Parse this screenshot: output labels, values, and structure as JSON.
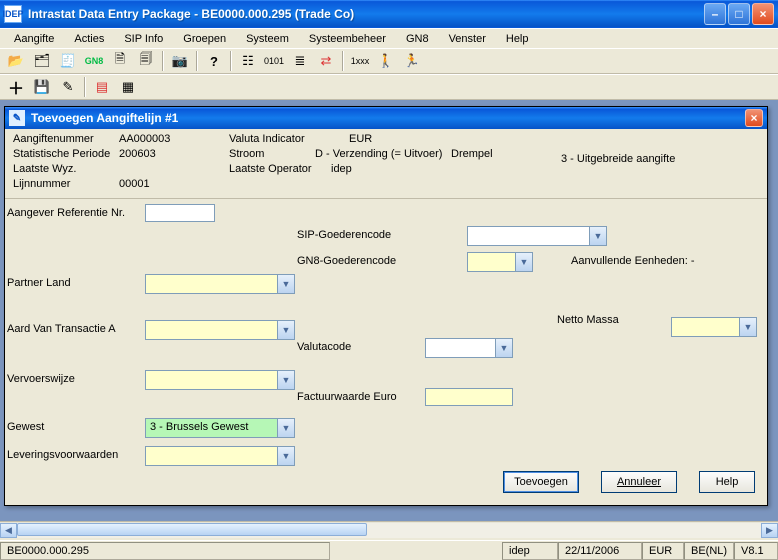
{
  "window": {
    "title": "Intrastat Data Entry Package - BE0000.000.295 (Trade Co)",
    "app_icon_label": "IDEP"
  },
  "menu": {
    "aangifte": "Aangifte",
    "acties": "Acties",
    "sipinfo": "SIP Info",
    "groepen": "Groepen",
    "systeem": "Systeem",
    "systeembeheer": "Systeembeheer",
    "gn8": "GN8",
    "venster": "Venster",
    "help": "Help"
  },
  "child": {
    "title": "Toevoegen Aangiftelijn #1"
  },
  "header": {
    "aangiftenummer_lbl": "Aangiftenummer",
    "aangiftenummer_val": "AA000003",
    "statperiode_lbl": "Statistische Periode",
    "statperiode_val": "200603",
    "laatstewyz_lbl": "Laatste Wyz.",
    "laatstewyz_val": "",
    "lijnnummer_lbl": "Lijnnummer",
    "lijnnummer_val": "00001",
    "valutaind_lbl": "Valuta Indicator",
    "valutaind_val": "EUR",
    "stroom_lbl": "Stroom",
    "stroom_val": "D - Verzending (= Uitvoer)",
    "laatsteop_lbl": "Laatste Operator",
    "laatsteop_val": "idep",
    "drempel_lbl": "Drempel",
    "drempel_val": "3 - Uitgebreide aangifte"
  },
  "form": {
    "aangeverref_lbl": "Aangever Referentie Nr.",
    "sipgoed_lbl": "SIP-Goederencode",
    "gn8goed_lbl": "GN8-Goederencode",
    "aanvullende_lbl": "Aanvullende Eenheden: -",
    "partnerland_lbl": "Partner Land",
    "aardtransactie_lbl": "Aard Van Transactie A",
    "nettomassa_lbl": "Netto Massa",
    "valutacode_lbl": "Valutacode",
    "vervoerswijze_lbl": "Vervoerswijze",
    "factuurwaarde_lbl": "Factuurwaarde Euro",
    "gewest_lbl": "Gewest",
    "gewest_val": "3 - Brussels Gewest",
    "leveringsvoorw_lbl": "Leveringsvoorwaarden"
  },
  "buttons": {
    "toevoegen": "Toevoegen",
    "annuleer": "Annuleer",
    "help": "Help"
  },
  "status": {
    "left": "BE0000.000.295",
    "op": "idep",
    "date": "22/11/2006",
    "cur": "EUR",
    "lang": "BE(NL)",
    "ver": "V8.1"
  }
}
